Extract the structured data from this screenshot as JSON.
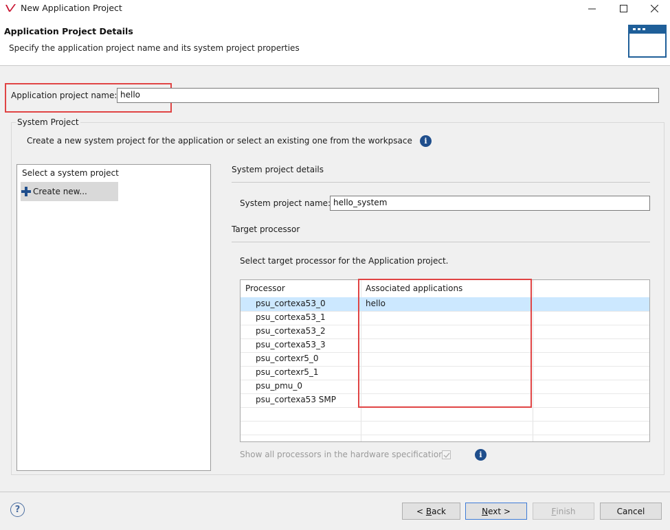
{
  "window": {
    "title": "New Application Project"
  },
  "header": {
    "title": "Application Project Details",
    "description": "Specify the application project name and its system project properties"
  },
  "app_project": {
    "label": "Application project name:",
    "value": "hello"
  },
  "system_project": {
    "group_title": "System Project",
    "description": "Create a new system project for the application or select an existing one from the workpsace",
    "list_header": "Select a system project",
    "create_new": "Create new..."
  },
  "details": {
    "section_title": "System project details",
    "name_label": "System project name:",
    "name_value": "hello_system"
  },
  "target": {
    "section_title": "Target processor",
    "instruction": "Select target processor for the Application project.",
    "columns": [
      "Processor",
      "Associated applications"
    ],
    "rows": [
      {
        "processor": "psu_cortexa53_0",
        "apps": "hello",
        "selected": true
      },
      {
        "processor": "psu_cortexa53_1",
        "apps": ""
      },
      {
        "processor": "psu_cortexa53_2",
        "apps": ""
      },
      {
        "processor": "psu_cortexa53_3",
        "apps": ""
      },
      {
        "processor": "psu_cortexr5_0",
        "apps": ""
      },
      {
        "processor": "psu_cortexr5_1",
        "apps": ""
      },
      {
        "processor": "psu_pmu_0",
        "apps": ""
      },
      {
        "processor": "psu_cortexa53 SMP",
        "apps": ""
      }
    ],
    "show_all_label": "Show all processors in the hardware specification",
    "show_all_checked": true
  },
  "buttons": {
    "back_prefix": "< ",
    "back_key": "B",
    "back_rest": "ack",
    "next_key": "N",
    "next_rest": "ext >",
    "finish_key": "F",
    "finish_rest": "inish",
    "cancel": "Cancel"
  },
  "colors": {
    "highlight_red": "#e04343",
    "selection": "#cce8ff",
    "info_blue": "#1f4e8c",
    "primary_border": "#3d7bd6"
  },
  "icons": {
    "app": "xilinx-logo-icon",
    "minimize": "minimize-icon",
    "maximize": "maximize-icon",
    "close": "close-icon",
    "banner": "window-icon",
    "add": "plus-icon",
    "info": "info-icon",
    "help": "help-icon"
  }
}
